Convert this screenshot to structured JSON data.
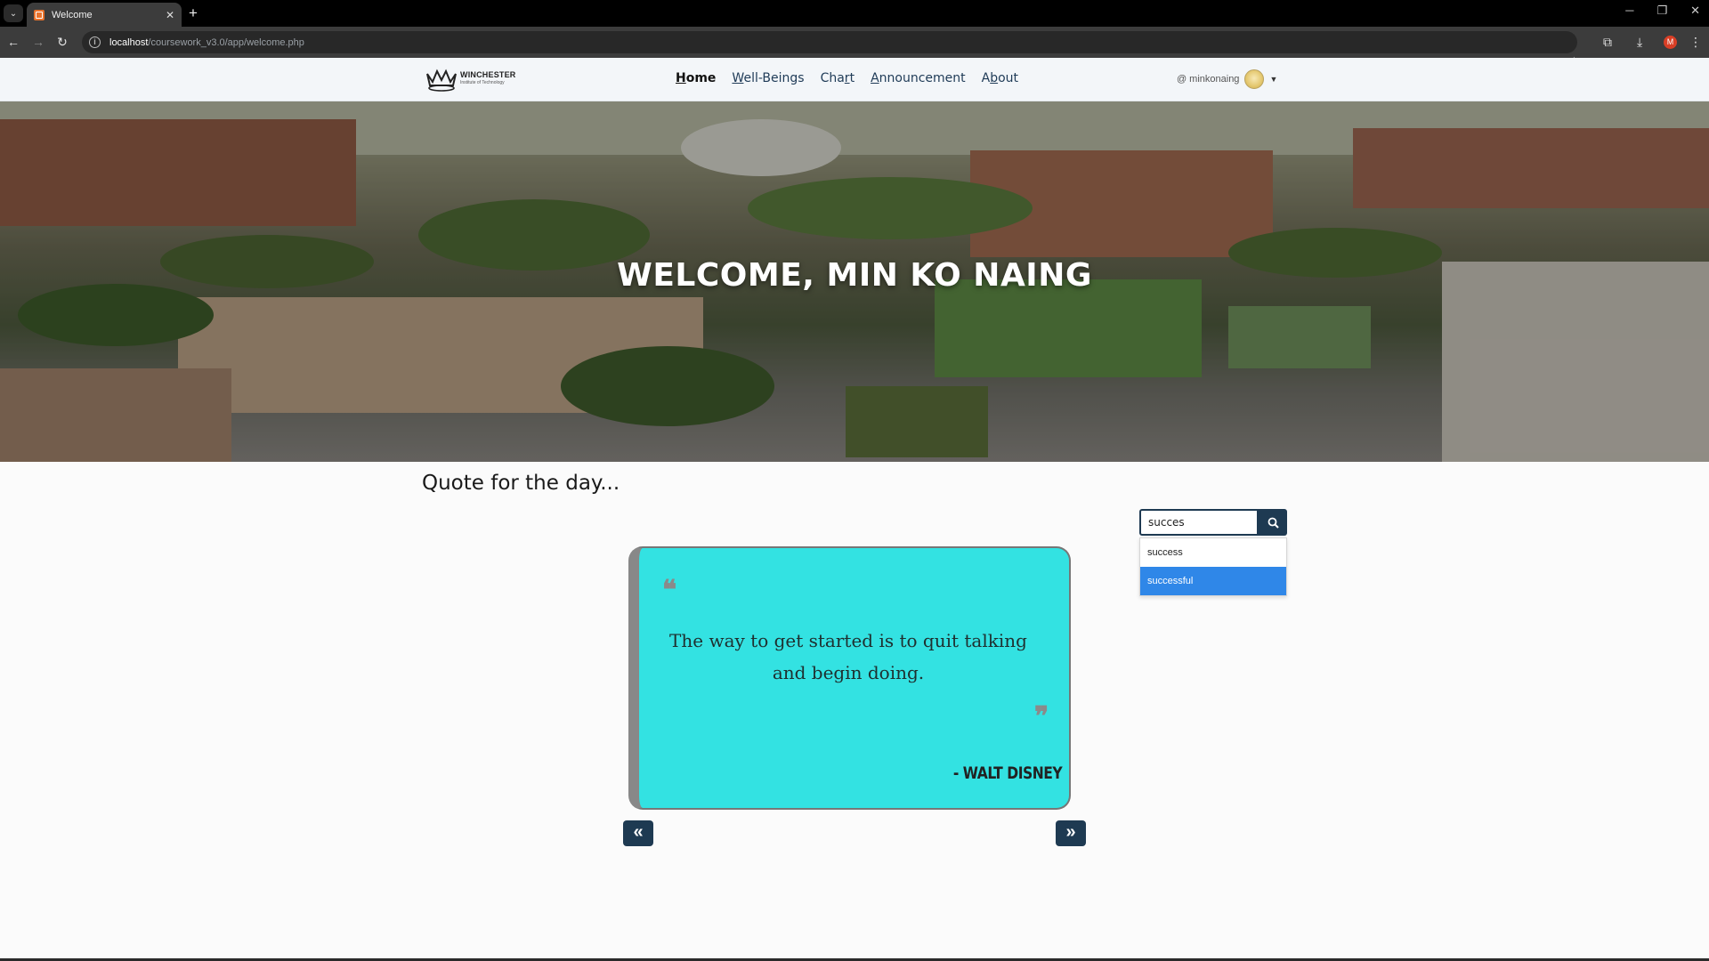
{
  "browser": {
    "tab_title": "Welcome",
    "tab_close": "✕",
    "new_tab": "+",
    "url_host": "localhost",
    "url_path": "/coursework_v3.0/app/welcome.php",
    "profile_initial": "M"
  },
  "navbar": {
    "logo_name": "WINCHESTER",
    "logo_sub": "Institute of Technology",
    "links": [
      {
        "label_u": "H",
        "label_rest": "ome",
        "active": true
      },
      {
        "label_u": "W",
        "label_rest": "ell-Beings",
        "active": false
      },
      {
        "label_pre": "Cha",
        "label_u": "r",
        "label_rest": "t",
        "active": false
      },
      {
        "label_u": "A",
        "label_rest": "nnouncement",
        "active": false
      },
      {
        "label_pre": "A",
        "label_u": "b",
        "label_rest": "out",
        "active": false
      }
    ],
    "user": {
      "at": "@",
      "username": "minkonaing"
    }
  },
  "hero": {
    "title": "WELCOME, MIN KO NAING"
  },
  "quote_section": {
    "heading": "Quote for the day...",
    "quote": "The way to get started is to quit talking and begin doing.",
    "author": "- WALT DISNEY",
    "open_mark": "❝",
    "close_mark": "❞",
    "prev": "«",
    "next": "»"
  },
  "search": {
    "value": "succes",
    "suggestions": [
      "success",
      "successful"
    ],
    "highlighted_index": 1
  },
  "colors": {
    "accent": "#1e3a52",
    "card": "#33e2e2",
    "suggest_active": "#2f87e8"
  }
}
